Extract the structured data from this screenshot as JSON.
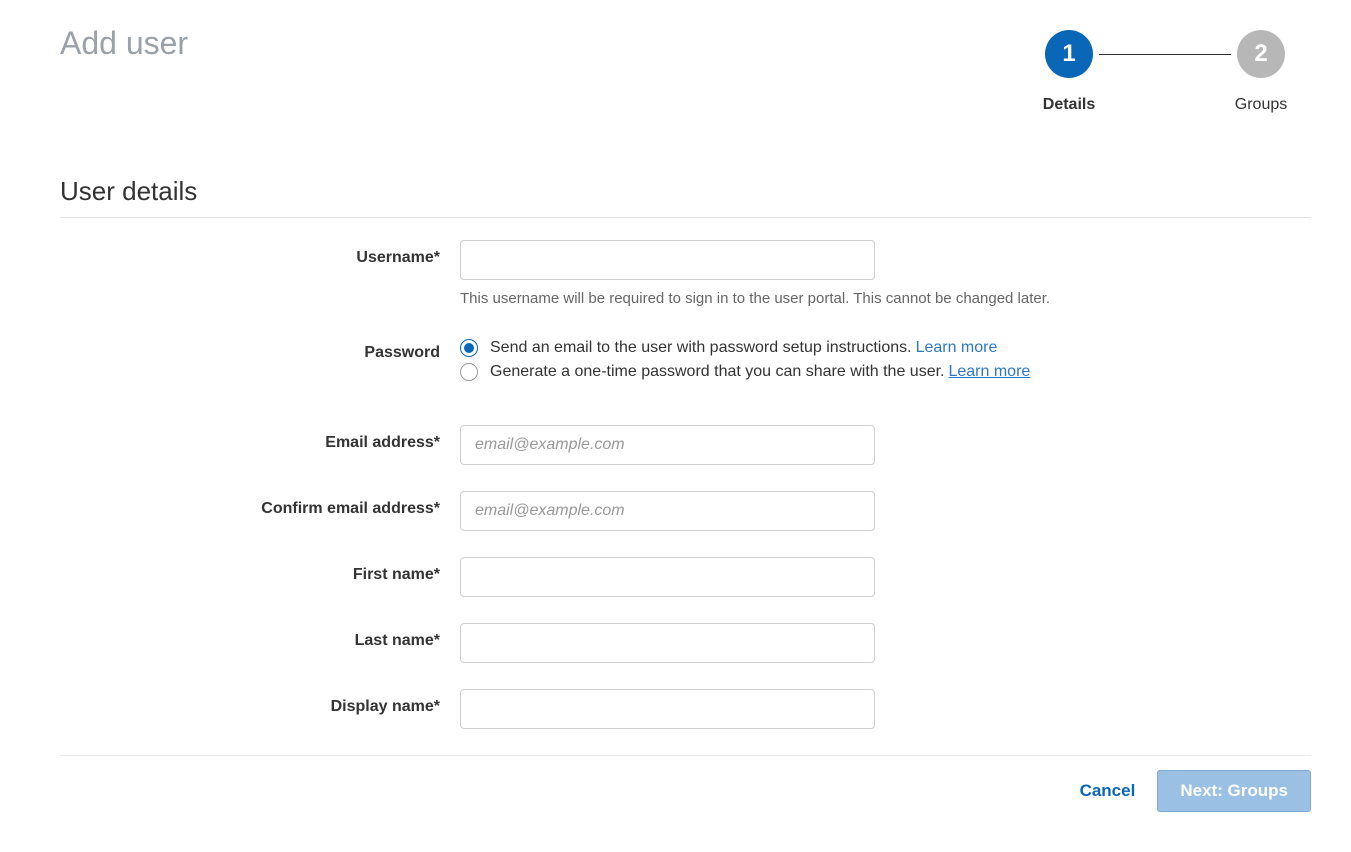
{
  "header": {
    "title": "Add user"
  },
  "wizard": {
    "steps": [
      {
        "num": "1",
        "label": "Details",
        "active": true
      },
      {
        "num": "2",
        "label": "Groups",
        "active": false
      }
    ]
  },
  "section": {
    "title": "User details"
  },
  "form": {
    "username": {
      "label": "Username*",
      "value": "",
      "hint": "This username will be required to sign in to the user portal. This cannot be changed later."
    },
    "password": {
      "label": "Password",
      "options": [
        {
          "text": "Send an email to the user with password setup instructions.",
          "link": "Learn more",
          "selected": true
        },
        {
          "text": "Generate a one-time password that you can share with the user.",
          "link": "Learn more",
          "selected": false
        }
      ]
    },
    "email": {
      "label": "Email address*",
      "placeholder": "email@example.com",
      "value": ""
    },
    "confirm_email": {
      "label": "Confirm email address*",
      "placeholder": "email@example.com",
      "value": ""
    },
    "first_name": {
      "label": "First name*",
      "value": ""
    },
    "last_name": {
      "label": "Last name*",
      "value": ""
    },
    "display_name": {
      "label": "Display name*",
      "value": ""
    }
  },
  "footer": {
    "cancel": "Cancel",
    "next": "Next: Groups"
  }
}
